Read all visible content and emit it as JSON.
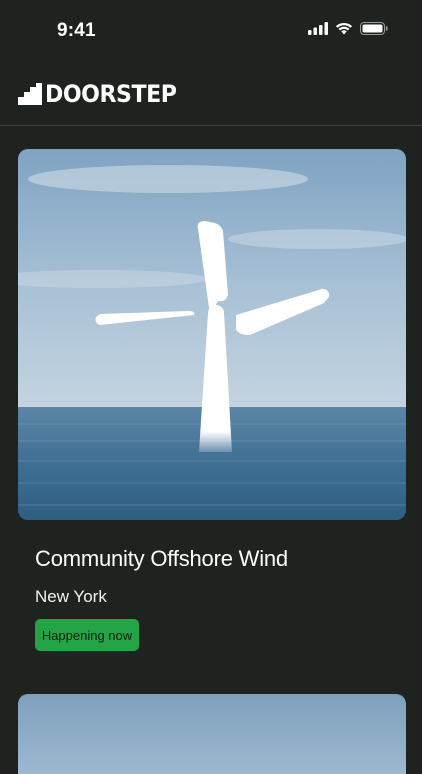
{
  "status_bar": {
    "time": "9:41",
    "icons": [
      "signal-icon",
      "wifi-icon",
      "battery-icon"
    ]
  },
  "header": {
    "brand": "DOORSTEP",
    "logo_icon": "stairs-logo-icon"
  },
  "cards": [
    {
      "title": "Community Offshore Wind",
      "location": "New York",
      "badge": "Happening now",
      "image": "offshore-wind-turbine-image"
    },
    {
      "image": "project-image"
    }
  ],
  "colors": {
    "background": "#1f231f",
    "badge": "#22a447",
    "divider": "#3b403b"
  }
}
